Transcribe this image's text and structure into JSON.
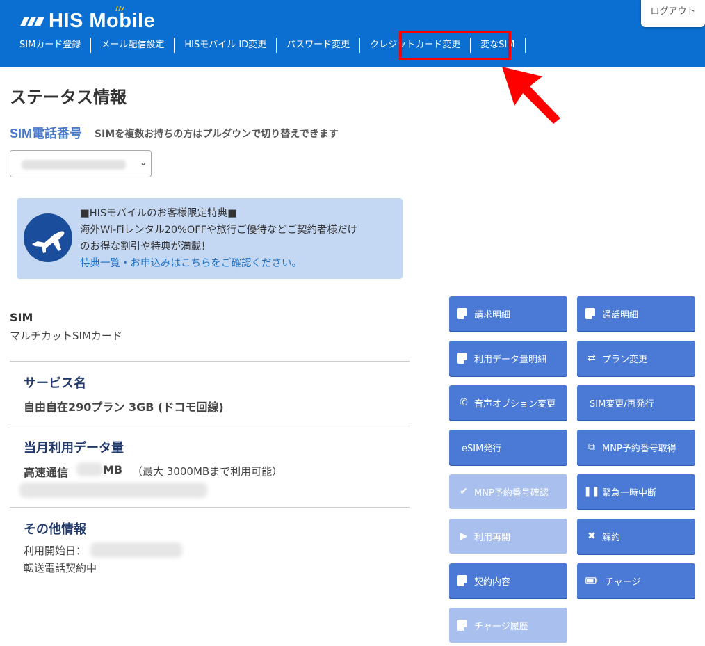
{
  "header": {
    "logo": "HIS Mobile",
    "logout": "ログアウト",
    "nav": [
      "SIMカード登録",
      "メール配信設定",
      "HISモバイル ID変更",
      "パスワード変更",
      "クレジットカード変更",
      "変なSIM"
    ]
  },
  "main": {
    "title": "ステータス情報",
    "sim_number_label": "SIM電話番号",
    "sim_number_note": "SIMを複数お持ちの方はプルダウンで切り替えできます"
  },
  "promo": {
    "line1": "■HISモバイルのお客様限定特典■",
    "line2": "海外Wi-Fiレンタル20%OFFや旅行ご優待などご契約者様だけ",
    "line3": "のお得な割引や特典が満載！",
    "link": "特典一覧・お申込みはこちらをご確認ください。"
  },
  "sim": {
    "title": "SIM",
    "type": "マルチカットSIMカード"
  },
  "service": {
    "title": "サービス名",
    "value": "自由自在290プラン 3GB (ドコモ回線)"
  },
  "usage": {
    "title": "当月利用データ量",
    "label": "高速通信",
    "unit": "MB",
    "note": "（最大 3000MBまで利用可能）"
  },
  "other": {
    "title": "その他情報",
    "start_label": "利用開始日：",
    "forwarding": "転送電話契約中"
  },
  "buttons": [
    {
      "label": "請求明細",
      "icon": "doc-icon"
    },
    {
      "label": "通話明細",
      "icon": "doc-icon"
    },
    {
      "label": "利用データ量明細",
      "icon": "doc-icon"
    },
    {
      "label": "プラン変更",
      "icon": "swap-icon"
    },
    {
      "label": "音声オプション変更",
      "icon": "phone-icon"
    },
    {
      "label": "SIM変更/再発行",
      "icon": ""
    },
    {
      "label": "eSIM発行",
      "icon": ""
    },
    {
      "label": "MNP予約番号取得",
      "icon": "share-icon"
    },
    {
      "label": "MNP予約番号確認",
      "icon": "check-icon"
    },
    {
      "label": "緊急一時中断",
      "icon": "pause-icon"
    },
    {
      "label": "利用再開",
      "icon": "play-icon"
    },
    {
      "label": "解約",
      "icon": "x-icon"
    },
    {
      "label": "契約内容",
      "icon": "doc-icon"
    },
    {
      "label": "チャージ",
      "icon": "battery-icon"
    },
    {
      "label": "チャージ履歴",
      "icon": "doc-icon"
    }
  ]
}
